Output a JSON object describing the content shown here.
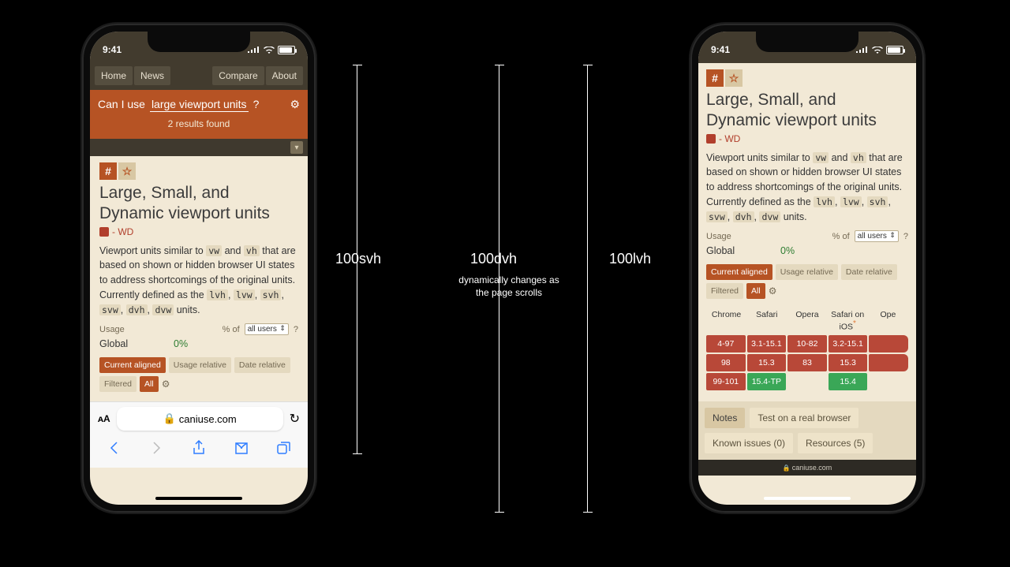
{
  "status": {
    "time": "9:41"
  },
  "nav": {
    "home": "Home",
    "news": "News",
    "compare": "Compare",
    "about": "About"
  },
  "search": {
    "prefix": "Can I use",
    "value": "large viewport units",
    "suffix": "?",
    "results": "2 results found"
  },
  "feature": {
    "title_l1": "Large, Small, and",
    "title_l2": "Dynamic viewport units",
    "wd": "- WD",
    "desc_1": "Viewport units similar to ",
    "desc_c1": "vw",
    "desc_2": " and ",
    "desc_c2": "vh",
    "desc_3": " that are based on shown or hidden browser UI states to address shortcomings of the original units. Currently defined as the ",
    "codes": [
      "lvh",
      "lvw",
      "svh",
      "svw",
      "dvh",
      "dvw"
    ],
    "desc_end": " units."
  },
  "usage": {
    "label": "Usage",
    "pct_of": "% of",
    "select": "all users",
    "q": "?",
    "global_label": "Global",
    "global_val": "0%"
  },
  "view": {
    "current": "Current aligned",
    "usage_rel": "Usage relative",
    "date_rel": "Date relative",
    "filtered": "Filtered",
    "all": "All"
  },
  "url": {
    "domain": "caniuse.com"
  },
  "labels": {
    "svh": "100svh",
    "dvh": "100dvh",
    "lvh": "100lvh",
    "dvh_sub": "dynamically changes as the page scrolls"
  },
  "compat": {
    "headers": [
      "Chrome",
      "Safari",
      "Opera",
      "Safari on iOS",
      "Ope"
    ],
    "r1": [
      "4-97",
      "3.1-15.1",
      "10-82",
      "3.2-15.1",
      ""
    ],
    "r2": [
      "98",
      "15.3",
      "83",
      "15.3",
      ""
    ],
    "r3": [
      "99-101",
      "15.4-TP",
      "",
      "15.4",
      ""
    ]
  },
  "tabs": {
    "notes": "Notes",
    "test": "Test on a real browser",
    "known": "Known issues (0)",
    "resources": "Resources (5)"
  }
}
